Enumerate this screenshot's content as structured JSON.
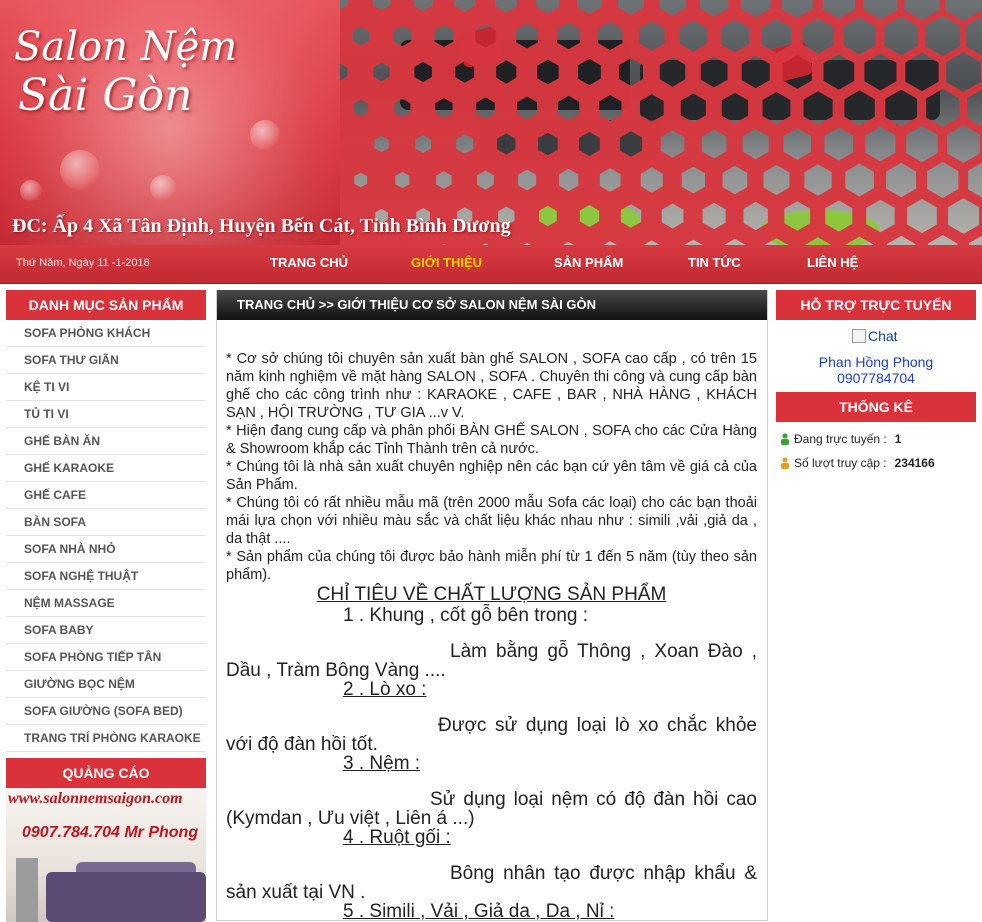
{
  "banner": {
    "logo_line1": "Salon Nệm",
    "logo_line2": "Sài Gòn",
    "address": "ĐC: Ấp 4 Xã Tân Định, Huyện Bến Cát, Tỉnh Bình Dương"
  },
  "nav": {
    "date": "Thứ Năm, Ngày 11 -1-2018",
    "items": [
      {
        "label": "TRANG CHỦ"
      },
      {
        "label": "GIỚI THIỆU"
      },
      {
        "label": "SẢN PHẨM"
      },
      {
        "label": "TIN TỨC"
      },
      {
        "label": "LIÊN HỆ"
      }
    ],
    "active_color": "#ffd200"
  },
  "sidebar": {
    "title": "DANH MỤC SẢN PHẨM",
    "items": [
      {
        "label": "SOFA PHÒNG KHÁCH"
      },
      {
        "label": "SOFA THƯ GIÃN"
      },
      {
        "label": "KỆ TI VI"
      },
      {
        "label": "TỦ TI VI"
      },
      {
        "label": "GHẾ BÀN ĂN"
      },
      {
        "label": "GHẾ KARAOKE"
      },
      {
        "label": "GHẾ CAFE"
      },
      {
        "label": "BÀN SOFA"
      },
      {
        "label": "SOFA NHÀ NHỎ"
      },
      {
        "label": "SOFA NGHỆ THUẬT"
      },
      {
        "label": "NỆM MASSAGE"
      },
      {
        "label": "SOFA BABY"
      },
      {
        "label": "SOFA PHÒNG TIẾP TÂN"
      },
      {
        "label": "GIƯỜNG BỌC NỆM"
      },
      {
        "label": "SOFA GIƯỜNG (SOFA BED)"
      },
      {
        "label": "TRANG TRÍ PHÒNG KARAOKE"
      }
    ],
    "ad_title": "QUẢNG CÁO",
    "ad_url": "www.salonnemsaigon.com",
    "ad_phone": "0907.784.704 Mr Phong"
  },
  "main": {
    "breadcrumb": "TRANG CHỦ >> GIỚI THIỆU CƠ SỞ SALON NỆM SÀI GÒN",
    "paragraphs": [
      "* Cơ sở chúng tôi chuyên sản xuất bàn ghế SALON , SOFA cao cấp , có trên 15 năm kinh nghiệm về mặt hàng SALON , SOFA . Chuyên thi công và cung cấp bàn ghế cho các công trình như : KARAOKE , CAFE , BAR , NHÀ HÀNG , KHÁCH SẠN , HỘI TRƯỜNG , TƯ GIA ...v V.",
      "* Hiện đang cung cấp và phân phối BÀN GHẾ SALON , SOFA cho các Cửa Hàng & Showroom khắp các Tỉnh Thành trên cả nước.",
      "* Chúng tôi là nhà sản xuất chuyên nghiệp nên các bạn cứ yên tâm về giá cả của Sản Phẩm.",
      "* Chúng tôi có rất nhiều mẫu mã (trên 2000 mẫu Sofa các loại) cho các bạn thoải mái lựa chọn với nhiều màu sắc và chất liệu khác nhau như : simili ,vải ,giả da , da thật ....",
      "* Sản phẩm của chúng tôi được bảo hành miễn phí từ 1 đến 5 năm (tùy theo sản phẩm)."
    ],
    "quality_title": "CHỈ TIÊU VỀ CHẤT LƯỢNG SẢN PHẨM",
    "q1_title": "1 . Khung , cốt gỗ bên trong :",
    "q1_text": "Làm bằng gỗ Thông , Xoan Đào , Dầu , Tràm Bông Vàng ....",
    "q2_title": "2 . Lò xo :",
    "q2_text": "Được sử dụng loại lò xo chắc khỏe với độ đàn hồi tốt.",
    "q3_title": "3 . Nệm :",
    "q3_text": "Sử dụng loại nệm có độ đàn hồi cao (Kymdan , Ưu việt , Liên á ...)",
    "q4_title": "4 . Ruột gối :",
    "q4_text": "Bông nhân tạo được nhập khẩu & sản xuất tại VN .",
    "q5_title": "5 . Simili , Vải , Giả da , Da , Nỉ :"
  },
  "right": {
    "support_title": "HỖ TRỢ TRỰC TUYẾN",
    "chat_alt": "Chat",
    "support_name": "Phan Hồng Phong",
    "support_phone": "0907784704",
    "stats_title": "THỐNG KÊ",
    "online_label": "Đang trực tuyến :",
    "online_value": "1",
    "visits_label": "Số lượt truy cập :",
    "visits_value": "234166"
  },
  "colors": {
    "brand_red": "#d9323a",
    "link_blue": "#1a3fcc"
  }
}
